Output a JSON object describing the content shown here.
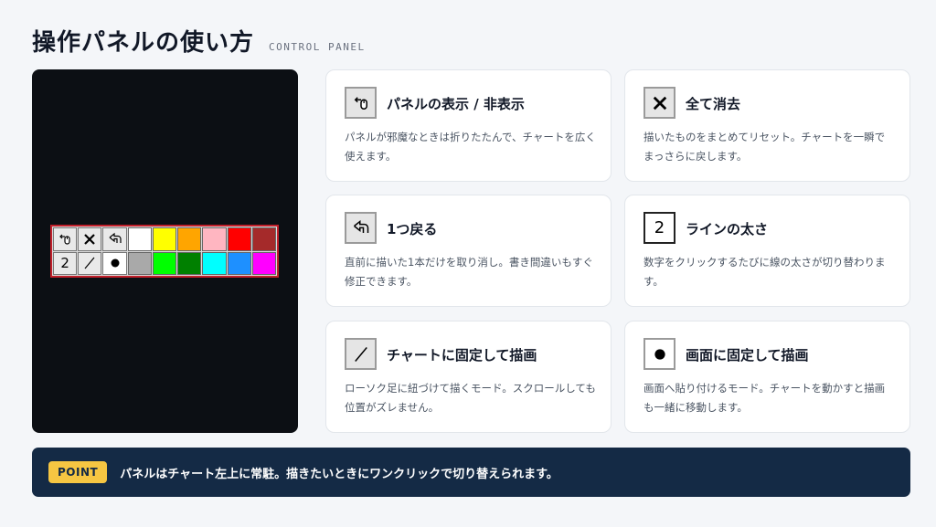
{
  "header": {
    "title": "操作パネルの使い方",
    "subtitle": "CONTROL PANEL"
  },
  "toolbar": {
    "row1_buttons": [
      {
        "icon": "hide-panel-icon"
      },
      {
        "icon": "clear-all-icon"
      },
      {
        "icon": "undo-icon"
      }
    ],
    "row2_buttons": [
      {
        "icon": "line-width-icon",
        "label": "2"
      },
      {
        "icon": "chart-fixed-line-icon"
      },
      {
        "icon": "screen-fixed-dot-icon"
      }
    ],
    "row1_colors": [
      "#ffffff",
      "#ffff00",
      "#ffa500",
      "#ffb6c1",
      "#ff0000",
      "#a52a2a"
    ],
    "row2_colors": [
      "#a9a9a9",
      "#00ff00",
      "#008000",
      "#00ffff",
      "#1e90ff",
      "#ff00ff"
    ],
    "border_color": "#c21f2a"
  },
  "cards": [
    {
      "icon": "hide-panel-icon",
      "title": "パネルの表示 / 非表示",
      "desc": "パネルが邪魔なときは折りたたんで、チャートを広く使えます。"
    },
    {
      "icon": "clear-all-icon",
      "title": "全て消去",
      "desc": "描いたものをまとめてリセット。チャートを一瞬でまっさらに戻します。"
    },
    {
      "icon": "undo-icon",
      "title": "1つ戻る",
      "desc": "直前に描いた1本だけを取り消し。書き間違いもすぐ修正できます。"
    },
    {
      "icon": "line-width-icon",
      "icon_label": "2",
      "title": "ラインの太さ",
      "desc": "数字をクリックするたびに線の太さが切り替わります。"
    },
    {
      "icon": "chart-fixed-line-icon",
      "title": "チャートに固定して描画",
      "desc": "ローソク足に紐づけて描くモード。スクロールしても位置がズレません。"
    },
    {
      "icon": "screen-fixed-dot-icon",
      "title": "画面に固定して描画",
      "desc": "画面へ貼り付けるモード。チャートを動かすと描画も一緒に移動します。"
    }
  ],
  "point": {
    "badge": "POINT",
    "text": "パネルはチャート左上に常駐。描きたいときにワンクリックで切り替えられます。"
  },
  "colors": {
    "navy": "#142a45",
    "badge": "#f6c642",
    "accent_red": "#c21f2a"
  }
}
